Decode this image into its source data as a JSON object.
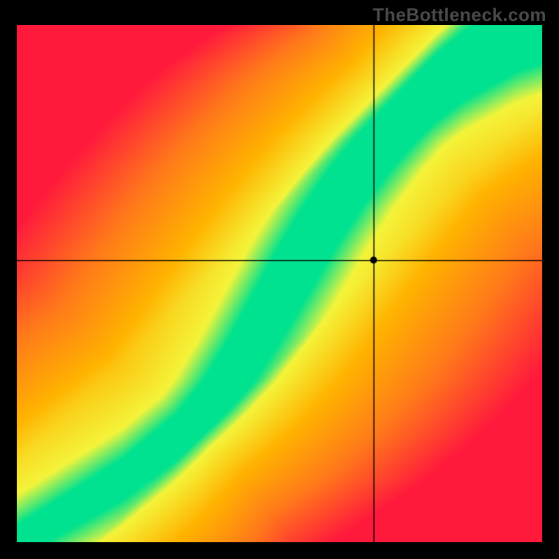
{
  "watermark": "TheBottleneck.com",
  "chart_data": {
    "type": "heatmap",
    "title": "",
    "xlabel": "",
    "ylabel": "",
    "xlim": [
      0,
      1
    ],
    "ylim": [
      0,
      1
    ],
    "optimal_curve": {
      "description": "Green optimal-pairing ridge; y as a function of x (normalized 0..1)",
      "x": [
        0.0,
        0.05,
        0.1,
        0.15,
        0.2,
        0.25,
        0.3,
        0.35,
        0.4,
        0.45,
        0.5,
        0.55,
        0.6,
        0.65,
        0.7,
        0.75,
        0.8,
        0.85,
        0.9,
        0.95,
        1.0
      ],
      "y": [
        0.0,
        0.03,
        0.06,
        0.09,
        0.12,
        0.16,
        0.2,
        0.25,
        0.31,
        0.39,
        0.48,
        0.57,
        0.65,
        0.72,
        0.78,
        0.83,
        0.88,
        0.92,
        0.95,
        0.98,
        1.0
      ]
    },
    "ridge_half_width": 0.045,
    "crosshair": {
      "x": 0.68,
      "y": 0.545
    },
    "marker": {
      "x": 0.68,
      "y": 0.545
    },
    "colors": {
      "optimal": "#00E28F",
      "near": "#F4F43A",
      "mid": "#FFB300",
      "far": "#FF7A1A",
      "worst": "#FF1A3C"
    }
  }
}
